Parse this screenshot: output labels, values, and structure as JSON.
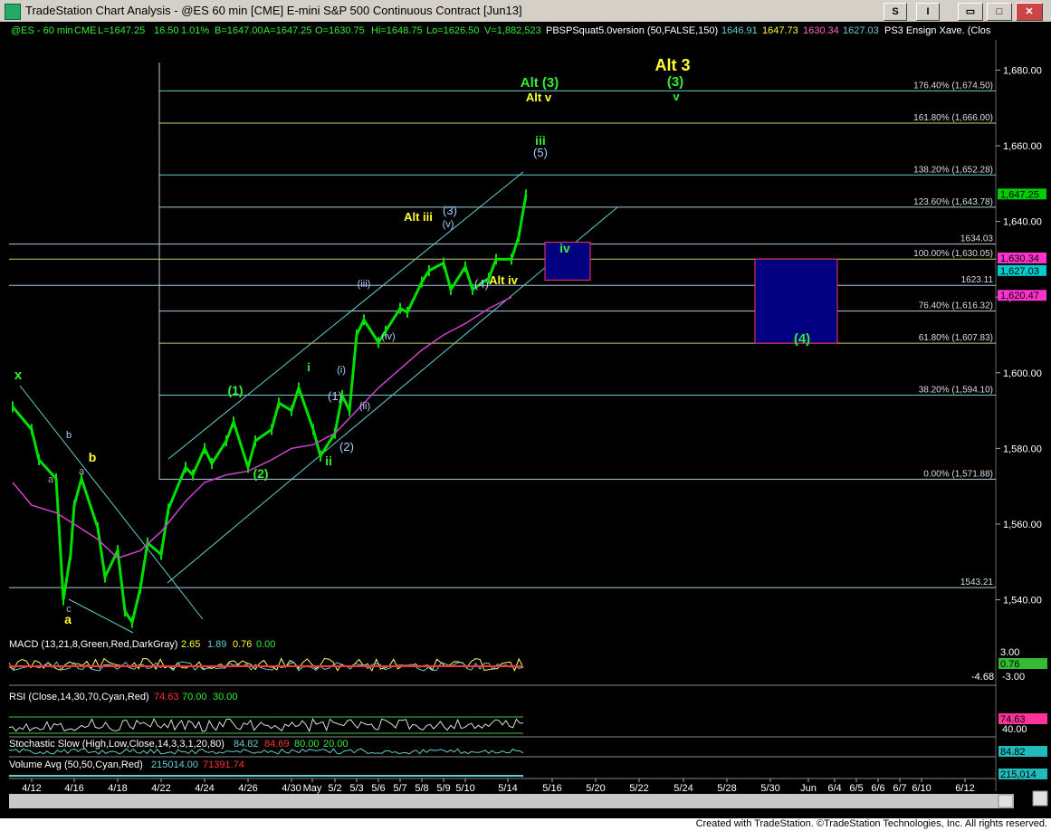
{
  "window": {
    "title": "TradeStation Chart Analysis - @ES 60 min [CME] E-mini S&P 500 Continuous Contract [Jun13]",
    "btn_s": "S",
    "btn_i": "I",
    "btn_min": "▭",
    "btn_max": "□",
    "btn_close": "✕"
  },
  "header": {
    "symbol": "@ES - 60 min",
    "exchange": "CME",
    "last": "L=1647.25",
    "change": "16.50",
    "change_pct": "1.01%",
    "bid": "B=1647.00",
    "ask": "A=1647.25",
    "open": "O=1630.75",
    "high": "Hi=1648.75",
    "low": "Lo=1626.50",
    "volume": "V=1,882,523",
    "indicator_name": "PBSPSquat5.0version (50,FALSE,150)",
    "ind_v1": "1646.91",
    "ind_v2": "1647.73",
    "ind_v3": "1630.34",
    "ind_v4": "1627.03",
    "ind_name2": "PS3 Ensign Xave. (Clos"
  },
  "colors": {
    "green_candle": "#00e000",
    "cyan": "#66cccc",
    "magenta_ma": "#cc44cc",
    "yellow": "#ffff33",
    "green_label": "#33ee33",
    "blue_label": "#aaccff",
    "box_fill": "#000080",
    "box_border": "#ff3366"
  },
  "chart_data": {
    "type": "line",
    "title": "",
    "ylim": [
      1532,
      1688
    ],
    "y_ticks": [
      "1,680.00",
      "1,660.00",
      "1,640.00",
      "1,620.00",
      "1,600.00",
      "1,580.00",
      "1,560.00",
      "1,540.00"
    ],
    "x_ticks": [
      "4/12",
      "4/16",
      "4/18",
      "4/22",
      "4/24",
      "4/26",
      "4/30",
      "May",
      "5/2",
      "5/3",
      "5/6",
      "5/7",
      "5/8",
      "5/9",
      "5/10",
      "5/14",
      "5/16",
      "5/20",
      "5/22",
      "5/24",
      "5/28",
      "5/30",
      "Jun",
      "6/4",
      "6/5",
      "6/6",
      "6/7",
      "6/10",
      "6/12"
    ],
    "series": [
      {
        "name": "",
        "points": [
          [
            "4/11",
            1591
          ],
          [
            "4/12",
            1585
          ],
          [
            "4/12",
            1577
          ],
          [
            "4/15",
            1572
          ],
          [
            "4/15",
            1540
          ],
          [
            "4/15",
            1552
          ],
          [
            "4/16",
            1565
          ],
          [
            "4/16",
            1572
          ],
          [
            "4/17",
            1559
          ],
          [
            "4/17",
            1546
          ],
          [
            "4/18",
            1553
          ],
          [
            "4/18",
            1537
          ],
          [
            "4/18",
            1534
          ],
          [
            "4/19",
            1543
          ],
          [
            "4/19",
            1555
          ],
          [
            "4/22",
            1552
          ],
          [
            "4/22",
            1564
          ],
          [
            "4/23",
            1575
          ],
          [
            "4/23",
            1573
          ],
          [
            "4/24",
            1580
          ],
          [
            "4/24",
            1576
          ],
          [
            "4/25",
            1582
          ],
          [
            "4/25",
            1587
          ],
          [
            "4/26",
            1575
          ],
          [
            "4/26",
            1582
          ],
          [
            "4/29",
            1585
          ],
          [
            "4/29",
            1592
          ],
          [
            "4/30",
            1590
          ],
          [
            "4/30",
            1596
          ],
          [
            "5/1",
            1585
          ],
          [
            "5/1",
            1578
          ],
          [
            "5/2",
            1584
          ],
          [
            "5/2",
            1594
          ],
          [
            "5/2",
            1590
          ],
          [
            "5/3",
            1610
          ],
          [
            "5/3",
            1614
          ],
          [
            "5/6",
            1608
          ],
          [
            "5/6",
            1611
          ],
          [
            "5/7",
            1617
          ],
          [
            "5/7",
            1616
          ],
          [
            "5/8",
            1624
          ],
          [
            "5/8",
            1627
          ],
          [
            "5/9",
            1629
          ],
          [
            "5/9",
            1622
          ],
          [
            "5/10",
            1628
          ],
          [
            "5/10",
            1622
          ],
          [
            "5/13",
            1625
          ],
          [
            "5/13",
            1630
          ],
          [
            "5/14",
            1630
          ],
          [
            "5/14",
            1636
          ],
          [
            "5/14",
            1647
          ]
        ]
      }
    ],
    "moving_average": [
      [
        "4/11",
        1571
      ],
      [
        "4/12",
        1565
      ],
      [
        "4/15",
        1563
      ],
      [
        "4/16",
        1560
      ],
      [
        "4/17",
        1556
      ],
      [
        "4/18",
        1551
      ],
      [
        "4/19",
        1553
      ],
      [
        "4/22",
        1558
      ],
      [
        "4/23",
        1566
      ],
      [
        "4/24",
        1571
      ],
      [
        "4/25",
        1573
      ],
      [
        "4/26",
        1574
      ],
      [
        "4/29",
        1577
      ],
      [
        "4/30",
        1580
      ],
      [
        "5/1",
        1581
      ],
      [
        "5/2",
        1584
      ],
      [
        "5/3",
        1590
      ],
      [
        "5/6",
        1596
      ],
      [
        "5/7",
        1601
      ],
      [
        "5/8",
        1606
      ],
      [
        "5/9",
        1610
      ],
      [
        "5/10",
        1613
      ],
      [
        "5/13",
        1617
      ],
      [
        "5/14",
        1620
      ]
    ],
    "hlines": [
      {
        "value": 1674.5,
        "label": "176.40% (1,674.50)"
      },
      {
        "value": 1666.0,
        "label": "161.80% (1,666.00)"
      },
      {
        "value": 1652.28,
        "label": "138.20% (1,652.28)"
      },
      {
        "value": 1643.78,
        "label": "123.60% (1,643.78)"
      },
      {
        "value": 1634.03,
        "label": "1634.03"
      },
      {
        "value": 1630.05,
        "label": "100.00% (1,630.05)"
      },
      {
        "value": 1623.11,
        "label": "1623.11"
      },
      {
        "value": 1616.32,
        "label": "76.40% (1,616.32)"
      },
      {
        "value": 1607.83,
        "label": "61.80% (1,607.83)"
      },
      {
        "value": 1594.1,
        "label": "38.20% (1,594.10)"
      },
      {
        "value": 1571.88,
        "label": "0.00% (1,571.88)"
      },
      {
        "value": 1543.21,
        "label": "1543.21"
      }
    ],
    "price_tags": [
      {
        "value": 1647.25,
        "label": "1,647.25",
        "color": "#00cc00"
      },
      {
        "value": 1630.34,
        "label": "1,630.34",
        "color": "#ff33cc"
      },
      {
        "value": 1627.03,
        "label": "1,627.03",
        "color": "#00cccc"
      },
      {
        "value": 1620.47,
        "label": "1,620.47",
        "color": "#ff33cc"
      }
    ],
    "wave_labels": [
      {
        "text": "x",
        "color": "#33ee33"
      },
      {
        "text": "a",
        "color": "#aaaaaa"
      },
      {
        "text": "b",
        "color": "#aaccff"
      },
      {
        "text": "a",
        "color": "#aaaaaa"
      },
      {
        "text": "b",
        "color": "#ffff33"
      },
      {
        "text": "c",
        "color": "#aaaaaa"
      },
      {
        "text": "a",
        "color": "#ffff33"
      },
      {
        "text": "(1)",
        "color": "#33ee33"
      },
      {
        "text": "(2)",
        "color": "#33ee33"
      },
      {
        "text": "i",
        "color": "#33ee33"
      },
      {
        "text": "ii",
        "color": "#33ee33"
      },
      {
        "text": "(i)",
        "color": "#aaccff"
      },
      {
        "text": "(1)",
        "color": "#aaccff"
      },
      {
        "text": "(ii)",
        "color": "#aaccff"
      },
      {
        "text": "(2)",
        "color": "#aaccff"
      },
      {
        "text": "(iii)",
        "color": "#aaccff"
      },
      {
        "text": "(iv)",
        "color": "#aaccff"
      },
      {
        "text": "Alt iii",
        "color": "#ffff33"
      },
      {
        "text": "(3)",
        "color": "#aaccff"
      },
      {
        "text": "(v)",
        "color": "#aaccff"
      },
      {
        "text": "(4)",
        "color": "#aaccff"
      },
      {
        "text": "Alt iv",
        "color": "#ffff33"
      },
      {
        "text": "iii",
        "color": "#33ee33"
      },
      {
        "text": "(5)",
        "color": "#aaccff"
      },
      {
        "text": "iv",
        "color": "#33ee33"
      },
      {
        "text": "Alt (3)",
        "color": "#33ee33"
      },
      {
        "text": "Alt v",
        "color": "#ffff33"
      },
      {
        "text": "Alt 3",
        "color": "#ffff33"
      },
      {
        "text": "(3)",
        "color": "#33ee33"
      },
      {
        "text": "v",
        "color": "#33ee33"
      },
      {
        "text": "(4)",
        "color": "#33ee33"
      }
    ]
  },
  "indicators": {
    "macd": {
      "label": "MACD (13,21,8,Green,Red,DarkGray)",
      "v1": "2.65",
      "v2": "1.89",
      "v3": "0.76",
      "v4": "0.00",
      "axis_top": "3.00",
      "axis_bottom": "-3.00",
      "tag1": "0.76",
      "tag2": "-4.68"
    },
    "rsi": {
      "label": "RSI (Close,14,30,70,Cyan,Red)",
      "v1": "74.63",
      "v2": "70.00",
      "v3": "30.00",
      "tag": "74.63",
      "axis": "40.00"
    },
    "stoch": {
      "label": "Stochastic Slow (High,Low,Close,14,3,3,1,20,80)",
      "v1": "84.82",
      "v2": "84.69",
      "v3": "80.00",
      "v4": "20.00",
      "tag": "84.82"
    },
    "volume": {
      "label": "Volume Avg (50,50,Cyan,Red)",
      "v1": "215014.00",
      "v2": "71391.74",
      "tag": "215,014"
    }
  },
  "footer": {
    "credit": "Created with TradeStation. ©TradeStation Technologies, Inc. All rights reserved."
  }
}
